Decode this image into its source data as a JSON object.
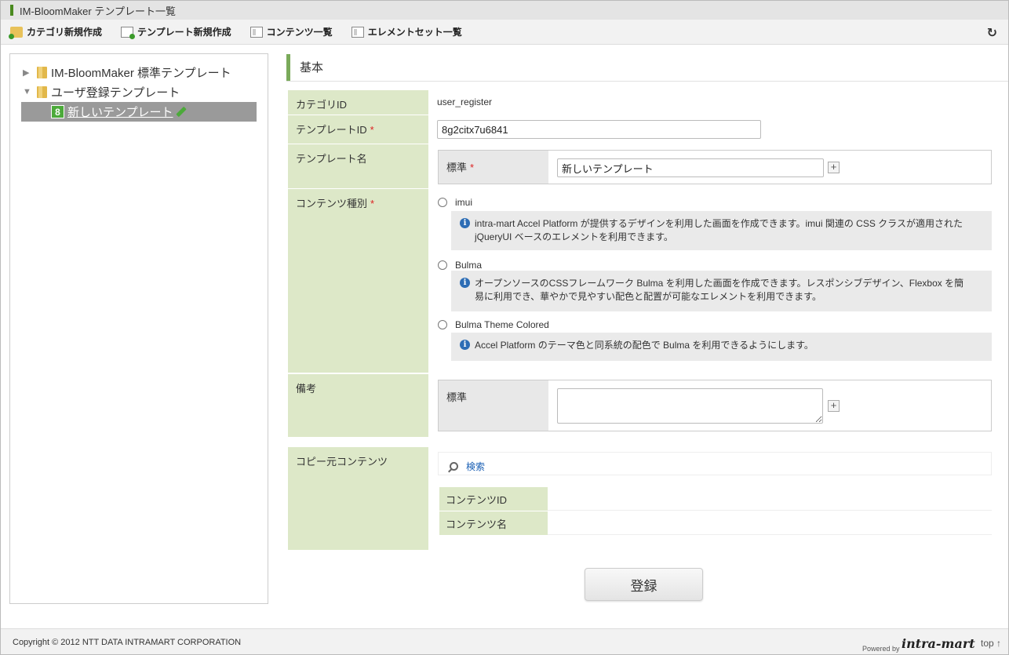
{
  "window": {
    "title": "IM-BloomMaker テンプレート一覧"
  },
  "toolbar": {
    "items": [
      {
        "label": "カテゴリ新規作成",
        "icon": "folder-add-icon"
      },
      {
        "label": "テンプレート新規作成",
        "icon": "document-add-icon"
      },
      {
        "label": "コンテンツ一覧",
        "icon": "list-icon"
      },
      {
        "label": "エレメントセット一覧",
        "icon": "list-icon"
      }
    ],
    "refresh_icon": "↻"
  },
  "tree": {
    "nodes": [
      {
        "label": "IM-BloomMaker 標準テンプレート",
        "expanded": false
      },
      {
        "label": "ユーザ登録テンプレート",
        "expanded": true
      }
    ],
    "selected": {
      "badge": "8",
      "label": "新しいテンプレート"
    }
  },
  "section": {
    "title": "基本"
  },
  "form": {
    "category_id": {
      "label": "カテゴリID",
      "value": "user_register"
    },
    "template_id": {
      "label": "テンプレートID",
      "required": "*",
      "value": "8g2citx7u6841"
    },
    "template_name": {
      "label": "テンプレート名",
      "sub_label": "標準",
      "required": "*",
      "value": "新しいテンプレート",
      "plus": "+"
    },
    "content_type": {
      "label": "コンテンツ種別",
      "required": "*",
      "options": [
        {
          "label": "imui",
          "info_line1": "intra-mart Accel Platform が提供するデザインを利用した画面を作成できます。imui 関連の CSS クラスが適用された",
          "info_line2": "jQueryUI ベースのエレメントを利用できます。"
        },
        {
          "label": "Bulma",
          "info_line1": "オープンソースのCSSフレームワーク Bulma を利用した画面を作成できます。レスポンシブデザイン、Flexbox を簡",
          "info_line2": "易に利用でき、華やかで見やすい配色と配置が可能なエレメントを利用できます。"
        },
        {
          "label": "Bulma Theme Colored",
          "info_line1": "Accel Platform のテーマ色と同系統の配色で Bulma を利用できるようにします。",
          "info_line2": ""
        }
      ]
    },
    "remarks": {
      "label": "備考",
      "sub_label": "標準",
      "value": "",
      "plus": "+"
    },
    "copy_source": {
      "label": "コピー元コンテンツ",
      "search_label": "検索",
      "content_id_label": "コンテンツID",
      "content_name_label": "コンテンツ名",
      "content_id": "",
      "content_name": ""
    },
    "submit_label": "登録"
  },
  "footer": {
    "copyright": "Copyright © 2012 NTT DATA INTRAMART CORPORATION",
    "powered_by": "Powered by",
    "logo_text": "intra-mart",
    "top_link": "top ↑"
  },
  "colors": {
    "label_bg": "#dde8c8",
    "accent_green": "#7aaa5a",
    "link_blue": "#1a5fb4",
    "required_red": "#d22222"
  }
}
